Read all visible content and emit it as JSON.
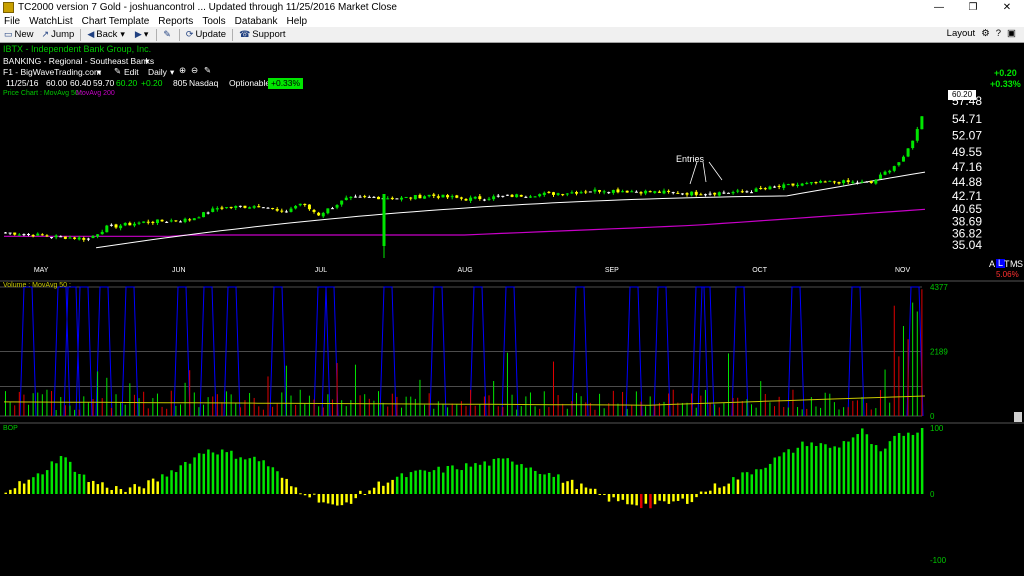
{
  "window": {
    "title": "TC2000 version 7 Gold - joshuancontrol  ... Updated through 11/25/2016  Market Close",
    "controls": [
      "—",
      "❐",
      "✕"
    ]
  },
  "menu": [
    "File",
    "WatchList",
    "Chart Template",
    "Reports",
    "Tools",
    "Databank",
    "Help"
  ],
  "toolbar": {
    "new": "New",
    "jump": "Jump",
    "back": "Back",
    "update": "Update",
    "support": "Support",
    "layout": "Layout"
  },
  "header": {
    "company": "IBTX - Independent Bank Group, Inc.",
    "industry": "BANKING - Regional - Southeast Banks",
    "source": "F1 - BigWaveTrading.com",
    "edit": "Edit",
    "period": "Daily",
    "date": "11/25/16",
    "open": "60.00",
    "high": "60.40",
    "low": "59.70",
    "close": "60.20",
    "change": "+0.20",
    "volume": "805",
    "exchange": "Nasdaq",
    "optionable": "Optionable",
    "pct": "+0.33%",
    "price_label": "Price Chart : MovAvg 50 :",
    "ma200_label": "MovAvg 200",
    "right_change": "+0.20",
    "right_pct": "+0.33%",
    "last_price": "60.20"
  },
  "price_axis": [
    "57.48",
    "54.71",
    "52.07",
    "49.55",
    "47.16",
    "44.88",
    "42.71",
    "40.65",
    "38.69",
    "36.82",
    "35.04"
  ],
  "months": [
    "MAY",
    "JUN",
    "JUL",
    "AUG",
    "SEP",
    "OCT",
    "NOV"
  ],
  "annotation": "Entries",
  "alt_label": {
    "a": "A",
    "l": "L",
    "t": "T",
    "m": "M",
    "s": "S",
    "pct": "5.06%"
  },
  "volume_panel": {
    "label": "Volume : MovAvg 50 :",
    "axis": [
      "4377",
      "2189",
      "0"
    ]
  },
  "bop_panel": {
    "label": "BOP",
    "axis": [
      "100",
      "0",
      "-100"
    ]
  },
  "colors": {
    "up": "#00e600",
    "down": "#ffff00",
    "neutral": "#ffffff",
    "ma50": "#ffffff",
    "ma200": "#c800c8",
    "vol_ma": "#c8c800",
    "blue": "#0000ff",
    "red": "#e00000"
  },
  "chart_data": [
    {
      "type": "line",
      "note": "price candles (close) for IBTX",
      "x": [
        "MAY",
        "JUN",
        "JUL",
        "AUG",
        "SEP",
        "OCT",
        "NOV",
        "11/25/16"
      ],
      "series": [
        {
          "name": "Price",
          "values": [
            37.0,
            40.5,
            42.0,
            42.5,
            43.5,
            44.5,
            48.0,
            60.2
          ]
        },
        {
          "name": "MovAvg 50",
          "values": [
            35.0,
            38.5,
            41.0,
            42.0,
            42.8,
            43.5,
            45.0,
            47.3
          ]
        },
        {
          "name": "MovAvg 200",
          "values": [
            36.5,
            36.4,
            36.4,
            36.6,
            37.0,
            37.6,
            38.5,
            39.6
          ]
        }
      ],
      "ylim": [
        35.04,
        57.48
      ]
    },
    {
      "type": "bar",
      "title": "Volume : MovAvg 50",
      "ylim": [
        0,
        4377
      ]
    },
    {
      "type": "bar",
      "title": "BOP",
      "ylim": [
        -100,
        100
      ]
    }
  ]
}
